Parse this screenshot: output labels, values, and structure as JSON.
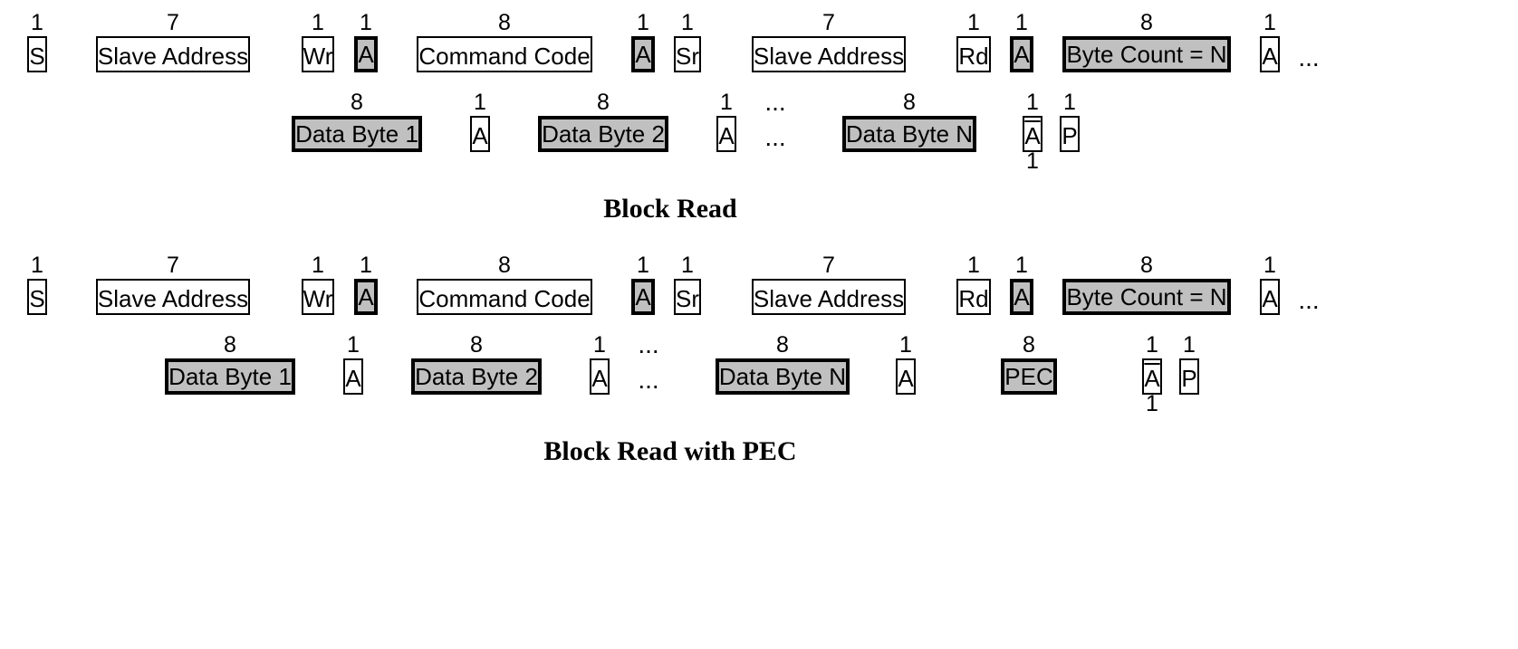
{
  "labels": {
    "S": "S",
    "SlaveAddress": "Slave Address",
    "Wr": "Wr",
    "A": "A",
    "CommandCode": "Command Code",
    "Sr": "Sr",
    "Rd": "Rd",
    "ByteCountN": "Byte Count = N",
    "DataByte1": "Data Byte 1",
    "DataByte2": "Data Byte 2",
    "DataByteN": "Data Byte N",
    "PEC": "PEC",
    "P": "P",
    "ellipsis": "…",
    "dots3": "...",
    "one": "1",
    "seven": "7",
    "eight": "8"
  },
  "captions": {
    "blockRead": "Block Read",
    "blockReadPEC": "Block Read with PEC"
  }
}
